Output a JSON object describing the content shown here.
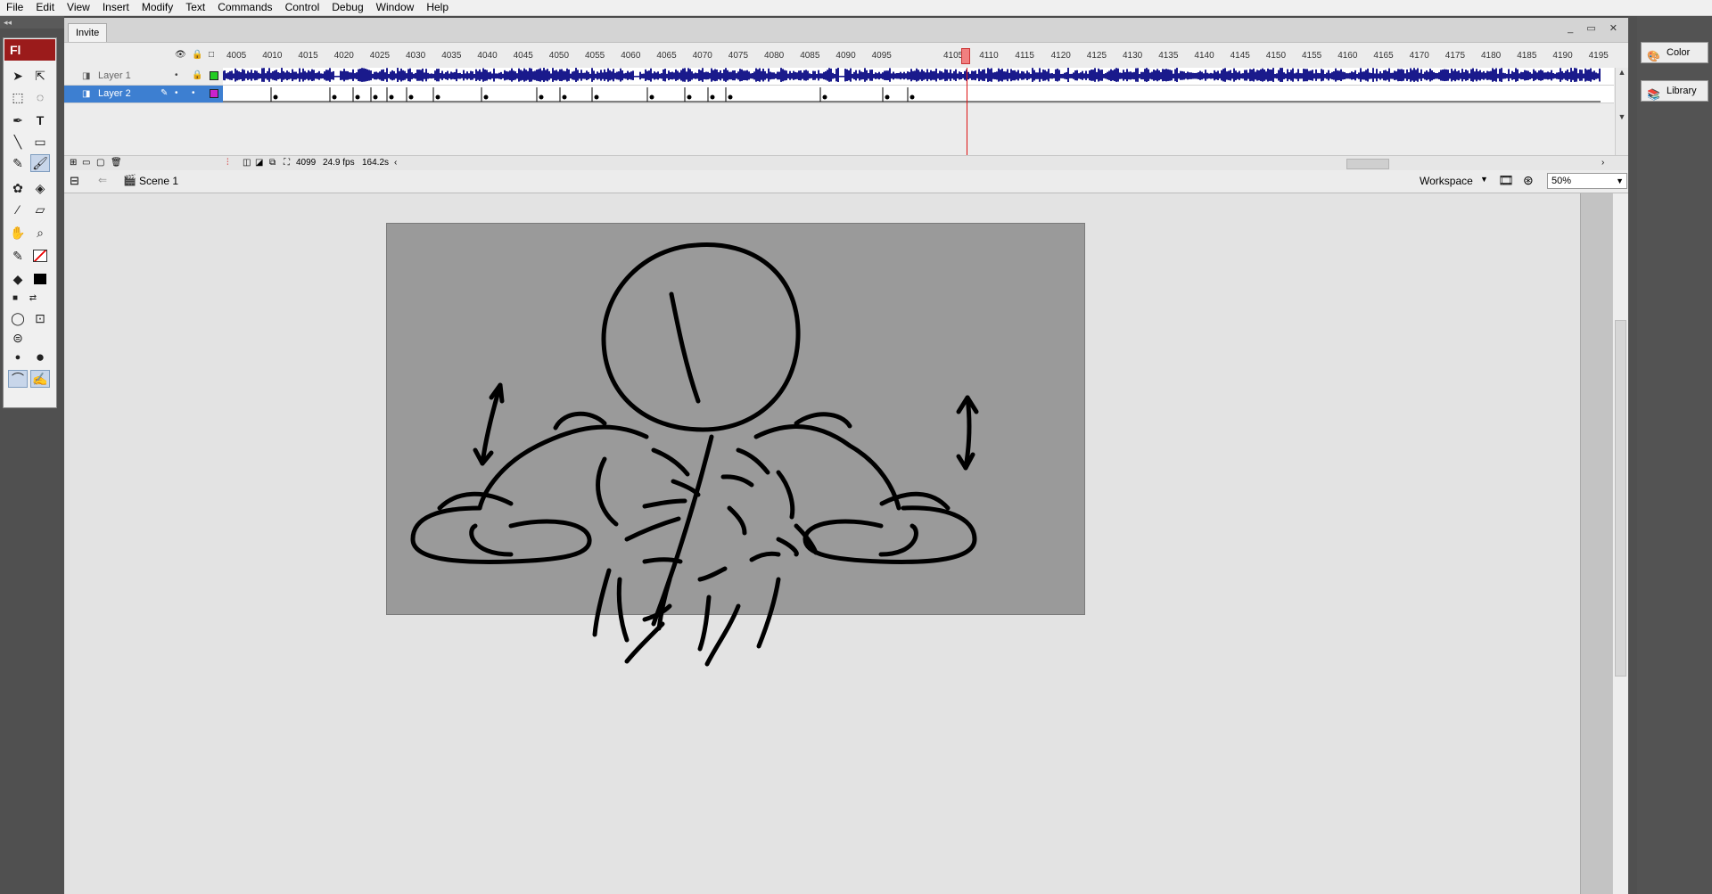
{
  "menu": [
    "File",
    "Edit",
    "View",
    "Insert",
    "Modify",
    "Text",
    "Commands",
    "Control",
    "Debug",
    "Window",
    "Help"
  ],
  "app": {
    "logo": "Fl",
    "collapse_glyph": "◂◂"
  },
  "document": {
    "tab": "Invite",
    "window_buttons": "_ ▭ ✕"
  },
  "timeline": {
    "frame_numbers": [
      "4005",
      "4010",
      "4015",
      "4020",
      "4025",
      "4030",
      "4035",
      "4040",
      "4045",
      "4050",
      "4055",
      "4060",
      "4065",
      "4070",
      "4075",
      "4080",
      "4085",
      "4090",
      "4095",
      "4105",
      "4110",
      "4115",
      "4120",
      "4125",
      "4130",
      "4135",
      "4140",
      "4145",
      "4150",
      "4155",
      "4160",
      "4165",
      "4170",
      "4175",
      "4180",
      "4185",
      "4190",
      "4195"
    ],
    "layers": [
      {
        "name": "Layer 1",
        "color": "#22cc22"
      },
      {
        "name": "Layer 2",
        "color": "#cc22cc"
      }
    ],
    "current_frame": "4099",
    "fps": "24.9 fps",
    "time": "164.2s"
  },
  "editbar": {
    "scene": "Scene 1",
    "workspace": "Workspace",
    "zoom": "50%"
  },
  "panels": [
    {
      "label": "Color",
      "icon": "color-icon"
    },
    {
      "label": "Library",
      "icon": "library-icon"
    }
  ],
  "colors": {
    "stage": "#9a9a9a",
    "active_layer": "#3d7fd1",
    "waveform": "#1a1a8c",
    "playhead": "#dd1111"
  }
}
